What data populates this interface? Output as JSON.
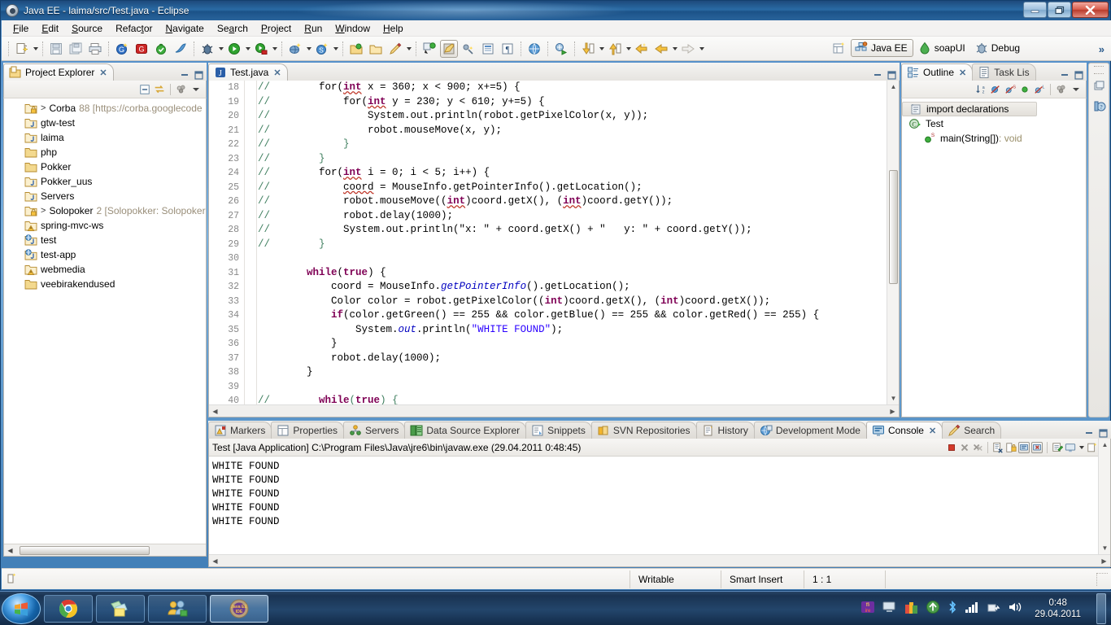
{
  "window": {
    "title": "Java EE - laima/src/Test.java - Eclipse",
    "minimize": "—",
    "maximize": "❐",
    "close": "✕"
  },
  "menu": [
    "File",
    "Edit",
    "Source",
    "Refactor",
    "Navigate",
    "Search",
    "Project",
    "Run",
    "Window",
    "Help"
  ],
  "toolbar": {
    "perspectives": [
      {
        "label": "Java EE",
        "active": true
      },
      {
        "label": "soapUI",
        "active": false
      },
      {
        "label": "Debug",
        "active": false
      }
    ],
    "overflow": "»"
  },
  "project_explorer": {
    "tab": "Project Explorer",
    "close": "✕",
    "items": [
      {
        "expander": ">",
        "label": "Corba",
        "meta": "88 [https://corba.googlecode",
        "icon": "folder-locked"
      },
      {
        "expander": "",
        "label": "gtw-test",
        "meta": "",
        "icon": "folder-java"
      },
      {
        "expander": "",
        "label": "laima",
        "meta": "",
        "icon": "folder-java"
      },
      {
        "expander": "",
        "label": "php",
        "meta": "",
        "icon": "folder-plain"
      },
      {
        "expander": "",
        "label": "Pokker",
        "meta": "",
        "icon": "folder-plain"
      },
      {
        "expander": "",
        "label": "Pokker_uus",
        "meta": "",
        "icon": "folder-java"
      },
      {
        "expander": "",
        "label": "Servers",
        "meta": "",
        "icon": "folder-java"
      },
      {
        "expander": ">",
        "label": "Solopoker",
        "meta": "2 [Solopokker: Solopoker",
        "icon": "folder-locked"
      },
      {
        "expander": "",
        "label": "spring-mvc-ws",
        "meta": "",
        "icon": "folder-warn"
      },
      {
        "expander": "",
        "label": "test",
        "meta": "",
        "icon": "folder-web"
      },
      {
        "expander": "",
        "label": "test-app",
        "meta": "",
        "icon": "folder-web"
      },
      {
        "expander": "",
        "label": "webmedia",
        "meta": "",
        "icon": "folder-warn"
      },
      {
        "expander": "",
        "label": "veebirakendused",
        "meta": "",
        "icon": "folder-plain"
      }
    ]
  },
  "editor": {
    "tab": "Test.java",
    "close": "✕",
    "first_line_number": 18,
    "lines": [
      {
        "n": 18,
        "segments": [
          {
            "t": "//        ",
            "c": "cm"
          },
          {
            "t": "for(",
            "c": ""
          },
          {
            "t": "int",
            "c": "kw sq"
          },
          {
            "t": " x = 360; x < 900; x+=5) {",
            "c": ""
          }
        ]
      },
      {
        "n": 19,
        "segments": [
          {
            "t": "//            ",
            "c": "cm"
          },
          {
            "t": "for(",
            "c": ""
          },
          {
            "t": "int",
            "c": "kw sq"
          },
          {
            "t": " y = 230; y < 610; y+=5) {",
            "c": ""
          }
        ]
      },
      {
        "n": 20,
        "segments": [
          {
            "t": "//                ",
            "c": "cm"
          },
          {
            "t": "System.out.println(robot.getPixelColor(x, y));",
            "c": ""
          }
        ]
      },
      {
        "n": 21,
        "segments": [
          {
            "t": "//                ",
            "c": "cm"
          },
          {
            "t": "robot.mouseMove(x, y);",
            "c": ""
          }
        ]
      },
      {
        "n": 22,
        "segments": [
          {
            "t": "//            }",
            "c": "cm"
          }
        ]
      },
      {
        "n": 23,
        "segments": [
          {
            "t": "//        }",
            "c": "cm"
          }
        ]
      },
      {
        "n": 24,
        "segments": [
          {
            "t": "//        ",
            "c": "cm"
          },
          {
            "t": "for(",
            "c": ""
          },
          {
            "t": "int",
            "c": "kw sq"
          },
          {
            "t": " i = 0; i < 5; i++) {",
            "c": ""
          }
        ]
      },
      {
        "n": 25,
        "segments": [
          {
            "t": "//            ",
            "c": "cm"
          },
          {
            "t": "coord",
            "c": "sq"
          },
          {
            "t": " = MouseInfo.getPointerInfo().getLocation();",
            "c": ""
          }
        ]
      },
      {
        "n": 26,
        "segments": [
          {
            "t": "//            ",
            "c": "cm"
          },
          {
            "t": "robot.mouseMove((",
            "c": ""
          },
          {
            "t": "int",
            "c": "kw sq"
          },
          {
            "t": ")coord.getX(), (",
            "c": ""
          },
          {
            "t": "int",
            "c": "kw sq"
          },
          {
            "t": ")coord.getY());",
            "c": ""
          }
        ]
      },
      {
        "n": 27,
        "segments": [
          {
            "t": "//            ",
            "c": "cm"
          },
          {
            "t": "robot.delay(1000);",
            "c": ""
          }
        ]
      },
      {
        "n": 28,
        "segments": [
          {
            "t": "//            ",
            "c": "cm"
          },
          {
            "t": "System.out.println(\"x: \" + coord.getX() + \"   y: \" + coord.getY());",
            "c": ""
          }
        ]
      },
      {
        "n": 29,
        "segments": [
          {
            "t": "//        }",
            "c": "cm"
          }
        ]
      },
      {
        "n": 30,
        "segments": [
          {
            "t": "",
            "c": ""
          }
        ]
      },
      {
        "n": 31,
        "segments": [
          {
            "t": "        ",
            "c": ""
          },
          {
            "t": "while",
            "c": "kw"
          },
          {
            "t": "(",
            "c": ""
          },
          {
            "t": "true",
            "c": "kw"
          },
          {
            "t": ") {",
            "c": ""
          }
        ]
      },
      {
        "n": 32,
        "segments": [
          {
            "t": "            coord = MouseInfo.",
            "c": ""
          },
          {
            "t": "getPointerInfo",
            "c": "fld"
          },
          {
            "t": "().getLocation();",
            "c": ""
          }
        ]
      },
      {
        "n": 33,
        "segments": [
          {
            "t": "            Color color = robot.getPixelColor((",
            "c": ""
          },
          {
            "t": "int",
            "c": "kw"
          },
          {
            "t": ")coord.getX(), (",
            "c": ""
          },
          {
            "t": "int",
            "c": "kw"
          },
          {
            "t": ")coord.getX());",
            "c": ""
          }
        ]
      },
      {
        "n": 34,
        "segments": [
          {
            "t": "            ",
            "c": ""
          },
          {
            "t": "if",
            "c": "kw"
          },
          {
            "t": "(color.getGreen() == 255 && color.getBlue() == 255 && color.getRed() == 255) {",
            "c": ""
          }
        ]
      },
      {
        "n": 35,
        "segments": [
          {
            "t": "                System.",
            "c": ""
          },
          {
            "t": "out",
            "c": "fld"
          },
          {
            "t": ".println(",
            "c": ""
          },
          {
            "t": "\"WHITE FOUND\"",
            "c": "str"
          },
          {
            "t": ");",
            "c": ""
          }
        ]
      },
      {
        "n": 36,
        "segments": [
          {
            "t": "            }",
            "c": ""
          }
        ]
      },
      {
        "n": 37,
        "segments": [
          {
            "t": "            robot.delay(1000);",
            "c": ""
          }
        ]
      },
      {
        "n": 38,
        "segments": [
          {
            "t": "        }",
            "c": ""
          }
        ]
      },
      {
        "n": 39,
        "segments": [
          {
            "t": "",
            "c": ""
          }
        ]
      },
      {
        "n": 40,
        "segments": [
          {
            "t": "//        ",
            "c": "cm"
          },
          {
            "t": "while",
            "c": "kw cm"
          },
          {
            "t": "(",
            "c": "cm"
          },
          {
            "t": "true",
            "c": "kw cm"
          },
          {
            "t": ") {",
            "c": "cm"
          }
        ]
      }
    ]
  },
  "outline": {
    "tabs": [
      {
        "label": "Outline",
        "active": true,
        "close": "✕"
      },
      {
        "label": "Task Lis",
        "active": false
      }
    ],
    "items": [
      {
        "label": "import declarations",
        "type": "",
        "indent": 0,
        "icon": "imports-icon",
        "selected": true
      },
      {
        "label": "Test",
        "type": "",
        "indent": 0,
        "icon": "class-icon",
        "selected": false
      },
      {
        "label": "main(String[])",
        "type": " : void",
        "indent": 1,
        "icon": "method-static-icon",
        "selected": false
      }
    ]
  },
  "bottom_panel": {
    "tabs": [
      {
        "label": "Markers",
        "active": false,
        "icon": "markers-icon"
      },
      {
        "label": "Properties",
        "active": false,
        "icon": "properties-icon"
      },
      {
        "label": "Servers",
        "active": false,
        "icon": "servers-icon"
      },
      {
        "label": "Data Source Explorer",
        "active": false,
        "icon": "datasource-icon"
      },
      {
        "label": "Snippets",
        "active": false,
        "icon": "snippets-icon"
      },
      {
        "label": "SVN Repositories",
        "active": false,
        "icon": "svn-icon"
      },
      {
        "label": "History",
        "active": false,
        "icon": "history-icon"
      },
      {
        "label": "Development Mode",
        "active": false,
        "icon": "devmode-icon"
      },
      {
        "label": "Console",
        "active": true,
        "icon": "console-icon",
        "close": "✕"
      },
      {
        "label": "Search",
        "active": false,
        "icon": "search-icon"
      }
    ],
    "console_launch": "Test [Java Application] C:\\Program Files\\Java\\jre6\\bin\\javaw.exe (29.04.2011 0:48:45)",
    "console_output": [
      "WHITE FOUND",
      "WHITE FOUND",
      "WHITE FOUND",
      "WHITE FOUND",
      "WHITE FOUND"
    ]
  },
  "statusbar": {
    "writable": "Writable",
    "insert_mode": "Smart Insert",
    "position": "1 : 1"
  },
  "taskbar": {
    "start": "start-orb",
    "items": [
      {
        "name": "chrome",
        "label": ""
      },
      {
        "name": "explorer",
        "label": ""
      },
      {
        "name": "messenger",
        "label": ""
      },
      {
        "name": "eclipse",
        "label": "Java EE IDE",
        "active": true
      }
    ],
    "tray_icons": [
      "fire-icon",
      "network-icon",
      "colors-icon",
      "update-icon",
      "bluetooth-icon",
      "signal-icon",
      "safely-remove-icon",
      "volume-icon"
    ],
    "time": "0:48",
    "date": "29.04.2011"
  }
}
